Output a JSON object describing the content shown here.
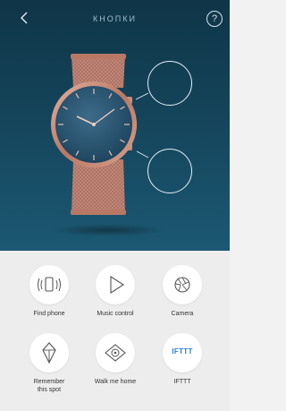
{
  "header": {
    "back_icon": "chevron-left-icon",
    "title": "КНОПКИ",
    "help_label": "?"
  },
  "colors": {
    "hero_top": "#0f3547",
    "hero_bottom": "#1c5873",
    "rose_gold": "#c98f7a",
    "dial": "#2f5c7a",
    "panel": "#ededed",
    "ifttt": "#2a7fd1"
  },
  "actions": [
    {
      "label": "Find phone",
      "icon": "vibrating-phone-icon"
    },
    {
      "label": "Music control",
      "icon": "play-triangle-icon"
    },
    {
      "label": "Camera",
      "icon": "camera-shutter-icon"
    },
    {
      "label_line1": "Remember",
      "label_line2": "this spot",
      "icon": "location-pin-icon"
    },
    {
      "label": "Walk me home",
      "icon": "eye-navigation-icon"
    },
    {
      "label": "IFTTT",
      "icon_text": "IFTTT"
    }
  ]
}
